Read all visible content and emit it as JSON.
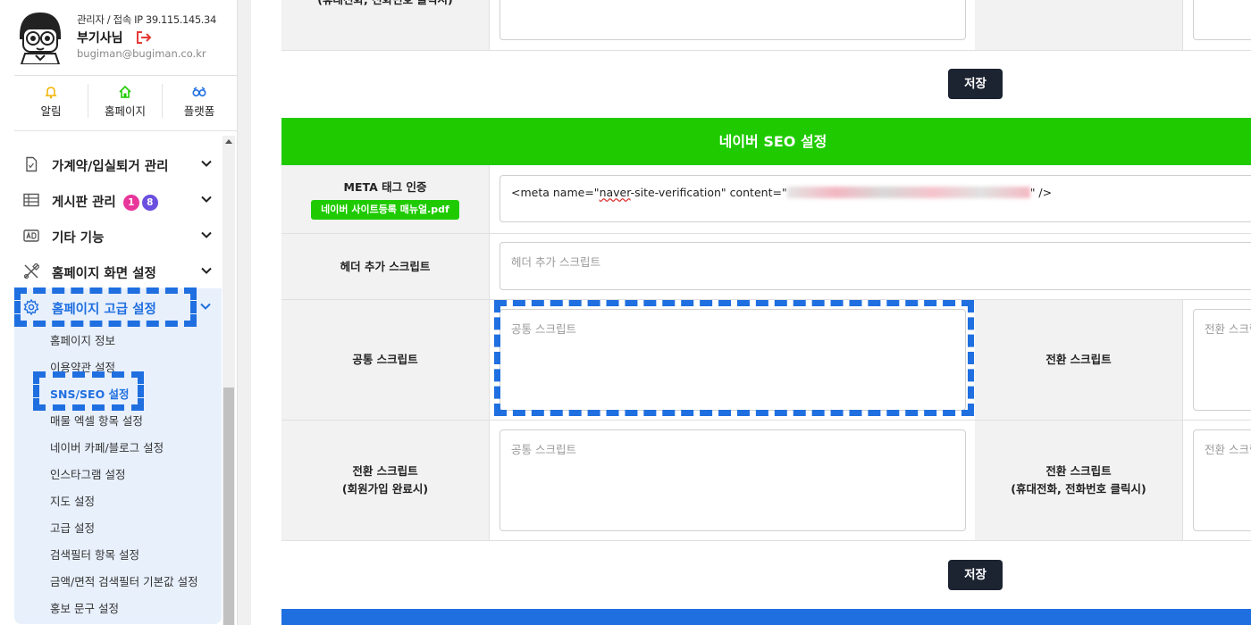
{
  "profile": {
    "admin_line": "관리자 / 접속 IP 39.115.145.34",
    "name": "부기사님",
    "email": "bugiman@bugiman.co.kr"
  },
  "quick_nav": [
    {
      "label": "알림",
      "icon": "bell-icon",
      "color": "#f2b300"
    },
    {
      "label": "홈페이지",
      "icon": "home-icon",
      "color": "#1fcb00"
    },
    {
      "label": "플랫폼",
      "icon": "platform-icon",
      "color": "#1f6fe0"
    }
  ],
  "menu": {
    "items": [
      {
        "label": "가계약/입실퇴거 관리",
        "icon": "document-icon"
      },
      {
        "label": "게시판 관리",
        "icon": "board-icon",
        "badges": [
          "1",
          "8"
        ]
      },
      {
        "label": "기타 기능",
        "icon": "ad-icon"
      },
      {
        "label": "홈페이지 화면 설정",
        "icon": "tools-icon"
      },
      {
        "label": "홈페이지 고급 설정",
        "icon": "gear-icon"
      }
    ],
    "sub_items": [
      "홈페이지 정보",
      "이용약관 설정",
      "SNS/SEO 설정",
      "매물 엑셀 항목 설정",
      "네이버 카페/블로그 설정",
      "인스타그램 설정",
      "지도 설정",
      "고급 설정",
      "검색필터 항목 설정",
      "금액/면적 검색필터 기본값 설정",
      "홍보 문구 설정"
    ]
  },
  "main": {
    "top_partial_label": "(휴대전화, 전화번호 클릭시)",
    "save_label": "저장",
    "section_title": "네이버 SEO 설정",
    "meta_label": "META 태그 인증",
    "pdf_button": "네이버 사이트등록 매뉴얼.pdf",
    "meta_code_prefix": "<meta name=\"",
    "meta_code_naver": "naver",
    "meta_code_middle": "-site-verification\" content=\"",
    "meta_code_suffix": "\" />",
    "header_script_label": "헤더 추가 스크립트",
    "header_script_placeholder": "헤더 추가 스크립트",
    "common_script_label": "공통 스크립트",
    "common_script_placeholder": "공통 스크립트",
    "conversion_script_label": "전환 스크립트",
    "conversion_script_placeholder": "전환 스크립트",
    "signup_conversion_label": "전환 스크립트",
    "signup_conversion_sub": "(회원가입 완료시)",
    "signup_conversion_placeholder": "공통 스크립트",
    "call_conversion_label": "전환 스크립트",
    "call_conversion_sub": "(휴대전화, 전화번호 클릭시)",
    "call_conversion_placeholder": "전환 스크립트"
  },
  "colors": {
    "accent_blue": "#1f6fe0",
    "section_green": "#1fcb00",
    "save_dark": "#1c2331",
    "logout_red": "#e53935"
  }
}
